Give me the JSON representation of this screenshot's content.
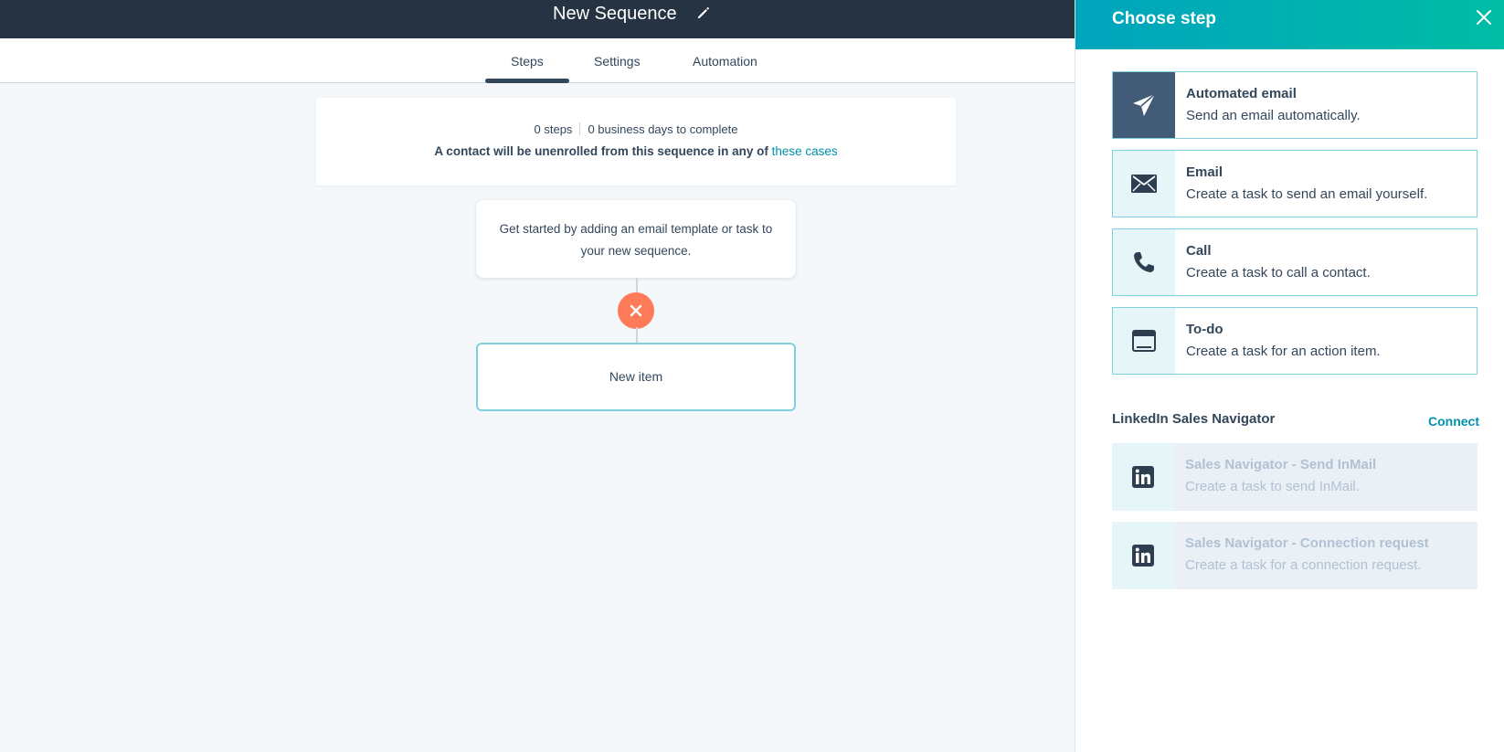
{
  "header": {
    "title": "New Sequence",
    "edit_icon": "pencil-icon"
  },
  "tabs": [
    {
      "label": "Steps",
      "active": true
    },
    {
      "label": "Settings",
      "active": false
    },
    {
      "label": "Automation",
      "active": false
    }
  ],
  "summary": {
    "steps": "0 steps",
    "days": "0 business days to complete",
    "unenroll_text": "A contact will be unenrolled from this sequence in any of",
    "unenroll_link": "these cases"
  },
  "canvas": {
    "start_prompt": "Get started by adding an email template or task to your new sequence.",
    "new_item": "New item"
  },
  "panel": {
    "title": "Choose step",
    "steps": [
      {
        "title": "Automated email",
        "description": "Send an email automatically.",
        "icon": "paper-plane-icon"
      },
      {
        "title": "Email",
        "description": "Create a task to send an email yourself.",
        "icon": "envelope-icon"
      },
      {
        "title": "Call",
        "description": "Create a task to call a contact.",
        "icon": "phone-icon"
      },
      {
        "title": "To-do",
        "description": "Create a task for an action item.",
        "icon": "todo-icon"
      }
    ],
    "linkedin": {
      "heading": "LinkedIn Sales Navigator",
      "connect": "Connect",
      "items": [
        {
          "title": "Sales Navigator - Send InMail",
          "description": "Create a task to send InMail.",
          "icon": "linkedin-icon"
        },
        {
          "title": "Sales Navigator - Connection request",
          "description": "Create a task for a connection request.",
          "icon": "linkedin-icon"
        }
      ]
    }
  },
  "colors": {
    "topbar": "#253342",
    "accent": "#0091ae",
    "remove": "#ff7a59",
    "panel_gradient_start": "#00a4bd",
    "panel_gradient_end": "#00bda5"
  }
}
